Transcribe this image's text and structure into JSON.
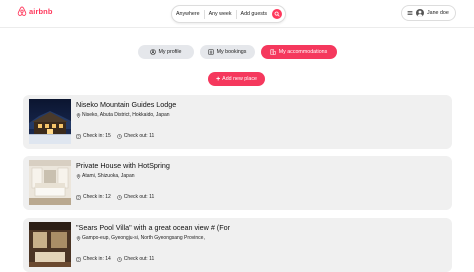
{
  "brand": {
    "name": "airbnb",
    "color": "#ff385c"
  },
  "search": {
    "anywhere": "Anywhere",
    "any_week": "Any week",
    "add_guests": "Add guests",
    "icon": "search-icon"
  },
  "user": {
    "name": "Jane doe",
    "menu_icon": "hamburger-icon",
    "avatar_icon": "user-avatar-icon"
  },
  "tabs": [
    {
      "label": "My profile",
      "icon": "user-icon",
      "active": false
    },
    {
      "label": "My bookings",
      "icon": "list-icon",
      "active": false
    },
    {
      "label": "My accommodations",
      "icon": "building-icon",
      "active": true
    }
  ],
  "add_place": {
    "label": "Add new place",
    "icon": "plus-icon"
  },
  "places": [
    {
      "title": "Niseko Mountain Guides Lodge",
      "location": "Niseko, Abuta District, Hokkaido, Japan",
      "check_in": "Check in: 15",
      "check_out": "Check out: 11"
    },
    {
      "title": "Private House with HotSpring",
      "location": "Atami, Shizuoka, Japan",
      "check_in": "Check in: 12",
      "check_out": "Check out: 11"
    },
    {
      "title": "\"Sears Pool Villa\" with a great ocean view # (For",
      "location": "Gampo-eup, Gyeongju-si, North Gyeongsang Province,",
      "check_in": "Check in: 14",
      "check_out": "Check out: 11"
    }
  ]
}
